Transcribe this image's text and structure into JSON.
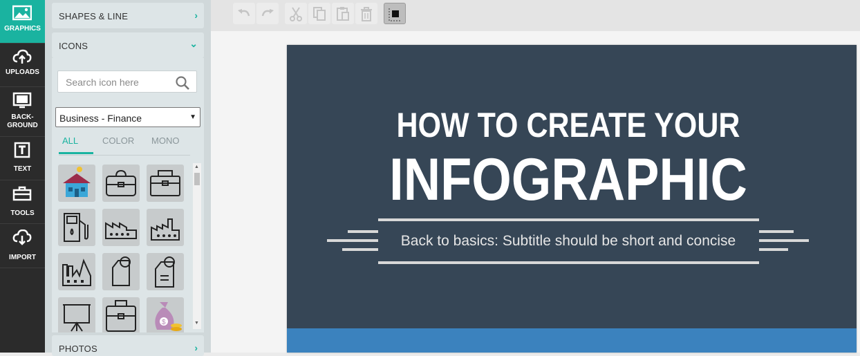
{
  "rail": {
    "items": [
      {
        "label": "GRAPHICS",
        "icon": "image-icon",
        "active": true
      },
      {
        "label": "UPLOADS",
        "icon": "cloud-upload-icon"
      },
      {
        "label1": "BACK-",
        "label2": "GROUND",
        "icon": "background-icon"
      },
      {
        "label": "TEXT",
        "icon": "text-icon"
      },
      {
        "label": "TOOLS",
        "icon": "toolbox-icon"
      },
      {
        "label": "IMPORT",
        "icon": "cloud-download-icon"
      }
    ]
  },
  "panel": {
    "shapes_title": "SHAPES & LINE",
    "icons_title": "ICONS",
    "photos_title": "PHOTOS",
    "search_placeholder": "Search icon here",
    "category": "Business - Finance",
    "tabs": [
      "ALL",
      "COLOR",
      "MONO"
    ],
    "active_tab": "ALL",
    "icon_tiles": [
      "house-coin-icon",
      "briefcase-icon",
      "briefcase-icon",
      "fuel-pump-icon",
      "factory-icon",
      "factory-icon",
      "factory-icon",
      "price-tag-icon",
      "price-tag-list-icon",
      "presentation-board-icon",
      "briefcase-icon",
      "money-bag-icon"
    ]
  },
  "toolbar": {
    "buttons": [
      "undo-icon",
      "redo-icon",
      "cut-icon",
      "copy-icon",
      "paste-icon",
      "delete-icon",
      "arrange-icon"
    ]
  },
  "slide": {
    "heading_line1": "HOW TO CREATE YOUR",
    "heading_line2": "INFOGRAPHIC",
    "subtitle": "Back to basics: Subtitle should be short and concise",
    "colors": {
      "background": "#364656",
      "bottom_band": "#3b82be",
      "accent": "#1ab3a0"
    }
  }
}
